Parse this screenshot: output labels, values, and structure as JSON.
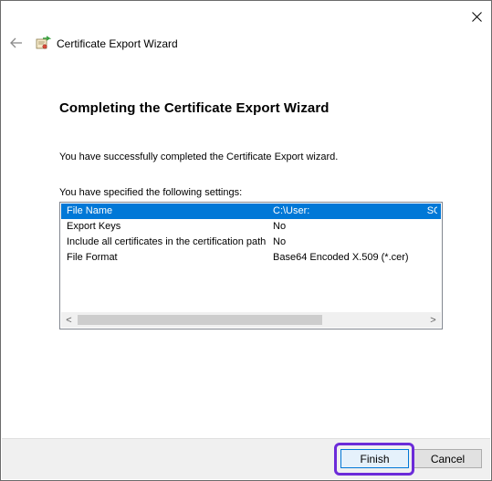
{
  "window": {
    "title": "Certificate Export Wizard"
  },
  "icons": {
    "close": "close-icon",
    "back": "back-arrow-icon",
    "wizard": "certificate-icon"
  },
  "heading": "Completing the Certificate Export Wizard",
  "success_text": "You have successfully completed the Certificate Export wizard.",
  "settings_label": "You have specified the following settings:",
  "settings": [
    {
      "name": "File Name",
      "value": "C:\\User:                                          SOA"
    },
    {
      "name": "Export Keys",
      "value": "No"
    },
    {
      "name": "Include all certificates in the certification path",
      "value": "No"
    },
    {
      "name": "File Format",
      "value": "Base64 Encoded X.509 (*.cer)"
    }
  ],
  "scrollbar": {
    "left_arrow": "<",
    "right_arrow": ">"
  },
  "buttons": {
    "finish": "Finish",
    "cancel": "Cancel"
  },
  "colors": {
    "selection": "#0078d7",
    "highlight": "#6c2bd9"
  }
}
